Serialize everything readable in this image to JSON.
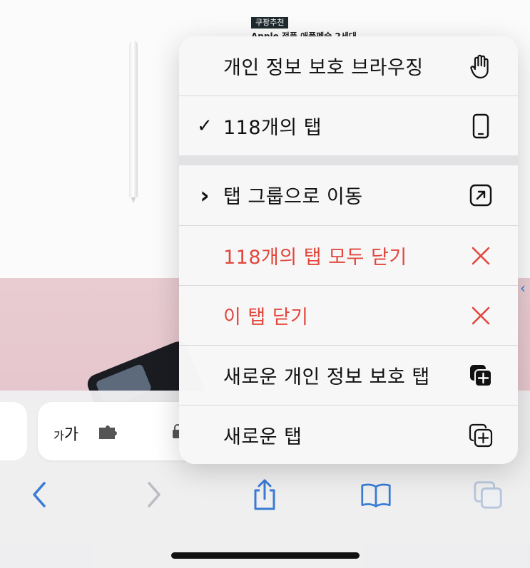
{
  "background": {
    "ad_tag": "쿠팡추천",
    "ad_title": "Apple 정품 애플펜슬 2세대"
  },
  "address_bar": {
    "text_size_label_small": "가",
    "text_size_label_large": "가"
  },
  "menu": {
    "items": [
      {
        "label": "개인 정보 보호 브라우징",
        "icon": "hand-icon",
        "checked": false,
        "red": false
      },
      {
        "label": "118개의 탭",
        "icon": "iphone-icon",
        "checked": true,
        "red": false
      },
      {
        "label": "탭 그룹으로 이동",
        "icon": "arrow-up-right-square-icon",
        "chevron": true,
        "red": false
      },
      {
        "label": "118개의 탭 모두 닫기",
        "icon": "close-x-icon",
        "red": true
      },
      {
        "label": "이 탭 닫기",
        "icon": "close-x-icon",
        "red": true
      },
      {
        "label": "새로운 개인 정보 보호 탭",
        "icon": "plus-square-on-square-filled-icon",
        "red": false
      },
      {
        "label": "새로운 탭",
        "icon": "plus-square-on-square-icon",
        "red": false
      }
    ],
    "check_glyph": "✓",
    "chevron_glyph": "›"
  },
  "colors": {
    "accent_blue": "#3a7bd5",
    "destructive_red": "#e2473c"
  }
}
